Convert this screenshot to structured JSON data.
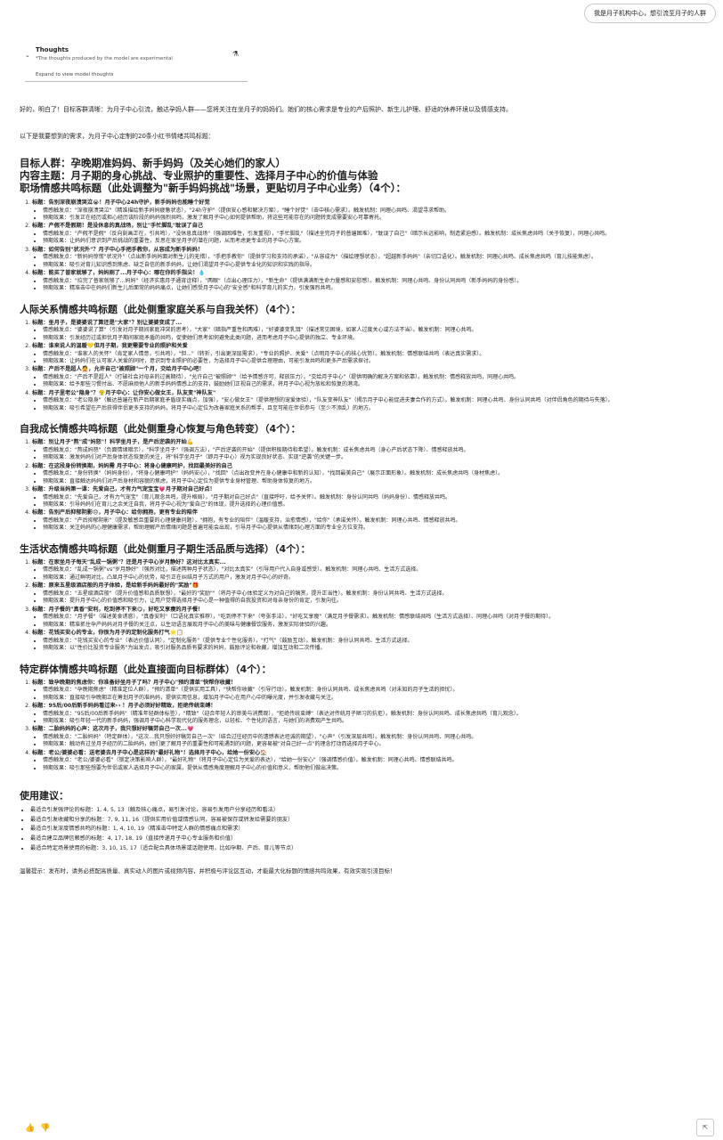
{
  "user_message": "我是月子机构中心，想引流至月子的人群",
  "thoughts": {
    "title": "Thoughts",
    "subtitle": "*The thoughts produced by the model are experimental",
    "expand": "Expand to view model thoughts"
  },
  "intro": "好的，明白了！目标客群清晰：为月子中心引流，触达孕妈人群——您将关注在坐月子的妈妈们。她们的核心需求是专业的产后照护、新生儿护理、舒适的休养环境以及情感支持。",
  "intro2": "以下是我要想到的需求，为月子中心定制的20条小红书情绪共鸣标题：",
  "header": {
    "audience": "目标人群：孕晚期准妈妈、新手妈妈（及关心她们的家人）",
    "theme": "内容主题：月子期的身心挑战、专业照护的重要性、选择月子中心的价值与体验",
    "section1": "职场情感共鸣标题（此处调整为\"新手妈妈挑战\"场景，更贴切月子中心业务）（4个）："
  },
  "sections": [
    {
      "title": "",
      "items": [
        {
          "t": "标题：告别深夜崩溃哭泣😭！月子中心24h守护，新手妈妈也能睡个好觉",
          "a": "情感触发点：\"深夜崩溃哭泣\"（精准描绘新手妈妈疲惫状态），\"24h守护\"（提供安心感和解决方案），\"睡个好觉\"（击中核心需求）。触发机制：同理心共鸣、渴望寻求帮助。",
          "b": "预期效果：引发正在经历或担心经历该阶段的妈妈强烈共鸣，激发了解月子中心如何提供帮助，将这些可能存在的问题转变成需要安心可靠寄托。"
        },
        {
          "t": "标题：产假不是假期！是没休息的真战场，别让\"手忙脚乱\"耽误了自己",
          "a": "情感触发点：\"产假不是假\"（反向刻画正在，引共鸣），\"没休息真战场\"（强调困难性，引发重视），\"手忙脚乱\"（描述坐完月子的普遍困难），\"耽误了自己\"（暗示长远影响，制造紧迫感）。触发机制：成长焦虑共鸣（关于恢复），同理心共鸣。",
          "b": "预期效果：让妈妈们意识到产后挑战的重要性，反思在家坐月子的潜在问题，从而考虑更专业的月子中心方案。"
        },
        {
          "t": "标题：如何告别\"状况外\"？月子中心手把手教你，从容成为新手妈妈！",
          "a": "情感触发点：\"新妈妈惊慌\"状况外\"（点出新手妈妈面对新生儿的无措），\"手把手教你\"（提供学习和支持的承诺），\"从容成为\"（描绘理想状态），\"超越新手妈妈\"（亲切口语化）。触发机制：同理心共鸣、成长焦虑共鸣（育儿技能焦虑）。",
          "b": "预期效果：吸引对育儿知识感到焦虑、缺乏自信的新手妈妈，让她们渴望月子中心提供专业化的知识和实践的指导。"
        },
        {
          "t": "标题：能买了普家就够了，妈妈刚了...月子中心：哪在你的手指尖！💧",
          "a": "情感触发点：\"拉完了普家就够了...妈妈\"（经济实惠月子通宵诠释），\"两眼\"（点出心理压力），\"新生命\"（提供满满新生命力量感和安慰感）。触发机制：同理心共鸣、身份认同共鸣（新手妈妈的身份感）。",
          "b": "预期效果：精准击中在妈妈们新生儿后面常的妈妈痛点，让她们感受月子中心的\"安全感\"和科学育儿的实力，引发强烈共鸣。"
        }
      ]
    },
    {
      "title": "人际关系情感共鸣标题（此处侧重家庭关系与自我关怀）（4个）：",
      "items": [
        {
          "t": "标题：坐月子，是婆婆说了算还是\"大家\"？别让婆婆变成了...",
          "a": "情感触发点：\"婆婆说了算\"（引发对月子期间家庭冲突的思考），\"大家\"（暗指严重性和两难），\"好婆婆变乳饵\"（描述常见困境，如家人过度关心或方法不当）。触发机制：同理心共鸣。",
          "b": "预期效果：引发经历过或担忧月子期间家庭矛盾的共鸣，促使她们思考如何避免此类问题，进而考虑月子中心提供的独立、专业环境。"
        },
        {
          "t": "标题：谁来说人的温暖💛但月子期，我更需要专业的照护和关爱",
          "a": "情感触发点：\"谁家人的关怀\"（肯定家人情意，引共鸣），\"但...\"（转折，引出更深层需求），\"专业的照护、关爱\"（点明月子中心的核心优势）。触发机制：情感联结共鸣（表达真实需求）。",
          "b": "预期效果：让妈妈们在认可家人关爱的同时，意识到专业照护的必要性，为选择月子中心提供合理理由，可能引发共鸣和更多产后需求探讨。"
        },
        {
          "t": "标题：产后不是超人🙅，允许自己\"被照顾\"一个月，交给月子中心吧！",
          "a": "情感触发点：\"产后不是超人\"（打破社会对母亲的过高期待），\"允许自己\"被照顾\"\"（给予情感许可，释放压力），\"交给月子中心\"（提供明确的解决方案和依靠）。触发机制：情感释放共鸣，同理心共鸣。",
          "b": "预期效果：给予那些习惯付出、不愿麻烦他人的新手妈妈情感上的支持，鼓励她们正视自己的需求，将月子中心视为放松和恢复的港湾。"
        },
        {
          "t": "标题：月子里老公\"隐身\"？😤月子中心：让你安心做女王，队友变\"神队友\"",
          "a": "情感触发点：\"老公隐身\"（触达普遍在新产后期家庭矛盾现实痛点，加强），\"安心做女王\"（提供理想的宠爱体验），\"队友变神队友\"（揭示月子中心能促进夫妻合作的方式）。触发机制：同理心共鸣、身份认同共鸣（对伴侣角色的期待与失落）。",
          "b": "预期效果：吸引希望在产后获得伴侣更多支持的妈妈，将月子中心定位为改善家庭关系的帮手，且至可能在伴侣参与（至少不添乱）的地方。"
        }
      ]
    },
    {
      "title": "自我成长情感共鸣标题（此处侧重身心恢复与角色转变）（4个）：",
      "items": [
        {
          "t": "标题：别让月子\"熬\"成\"妈怒\"！科学坐月子，是产后逆袭的开始💪",
          "a": "情感触发点：\"熬成妈怒\"（负面情绪暗示），\"科学坐月子\"（强调方法），\"产后逆袭的开始\"（提供积极期待和希望）。触发机制：成长焦虑共鸣（身心产后状态下降）、情感释放共鸣。",
          "b": "预期效果：激发妈妈们对产后身体状态恢复的关注，将\"科学坐月子\"（即月子中心）视为实现良好状态、实现\"逆袭\"的关键一步。"
        },
        {
          "t": "标题：在这段身份转换期，妈妈需 月子中心：将身心健康呵护，找回最美好的自己",
          "a": "情感触发点：\"身份转换\"（妈妈身份），\"将身心健康呵护\"（妈妈安心），\"找回\"（点出改变并在身心健康中和新的认知），\"找回最美自己\"（展示正面形象）。触发机制：成长焦虑共鸣（身材焦虑）。",
          "b": "预期效果：直接触达妈妈们对产后身材和容貌的焦虑，将月子中心定位为提供专业身材管理、帮助身体恢复的地方。"
        },
        {
          "t": "标题：升级当妈第一课：先爱自己，才有力气宠宝宝💗月子期对自己好点！",
          "a": "情感触发点：\"先爱自己，才有力气宠宝\"（育儿观念共鸣，提升格局），\"月子期对自己好点\"（直接呼吁，给予关怀）。触发机制：身份认同共鸣（妈妈身份）、情感释放共鸣。",
          "b": "预期效果：引导妈妈们在育儿之余关注自我，将月子中心视为\"爱自己\"的体现，提升选择的心理价值感。"
        },
        {
          "t": "标题：告别产后抑郁阴影😞，月子中心：给你拥抱，更有专业的陪伴",
          "a": "情感触发点：\"产后抑郁阴影\"（提及敏感且重要的心理健康问题），\"拥抱，有专业的陪伴\"（温暖支持，治愈情感），\"给你\"（承诺关怀）。触发机制：同理心共鸣、情感释放共鸣。",
          "b": "预期效果：关注妈妈的心理健康需求，帮助理解产后情绪问题是普遍可能会出现，引导月子中心提供从情绪到心理方面的专业全方位支持。"
        }
      ]
    },
    {
      "title": "生活状态情感共鸣标题（此处侧重月子期生活品质与选择）（4个）：",
      "items": [
        {
          "t": "标题：在家坐月子每天\"乱成一锅粥\"？还是月子中心岁月静好？这对比太真实...",
          "a": "情感触发点：\"乱成一锅粥\"vs\"岁月静好\"（强烈对比，描述两种月子状态），\"对比太真实\"（引导用户代入自身或感受）。触发机制：同理心共鸣、生活方式选择。",
          "b": "预期效果：通过鲜明对比，凸显月子中心的优势，吸引正在纠结月子方式的用户，激发对月子中心的好奇。"
        },
        {
          "t": "标题：原来五星级酒店般的月子体验，是给新手妈妈最好的\"奖励\"🎁",
          "a": "情感触发点：\"五星级酒店般\"（提升价值感和品质联想），\"最好的\"奖励\"\"（将月子中心体验定义为对自己的犒赏，提升正当性）。触发机制：身份认同共鸣、生活方式选择。",
          "b": "预期效果：提升月子中心的价值感和吸引力，让用户觉得选择月子中心是一种值得的自我投资和对母亲身份的肯定，引发向往。"
        },
        {
          "t": "标题：月子餐的\"真香\"安利，吃到停不下来😋，好吃又享瘦的月子餐！",
          "a": "情感触发点：\"月子餐\"（描述美食诱惑），\"真香安利\"（口语化真实推荐），\"吃到停不下来\"（夸张手法），\"好吃又享瘦\"（满足月子餐需求）。触发机制：情感联结共鸣（生活方式选择）、同理心共鸣（对月子餐的期待）。",
          "b": "预期效果：精准抓住孕产妈妈对月子餐的关注点，以生动语言展现月子中心的美味与健康餐饮服务，激发实际体验的兴趣。"
        },
        {
          "t": "标题：花钱买安心的专业，你很为月子的定制化服务打气🌟📋",
          "a": "情感触发点：\"花钱买安心的专业\"（表达价值认同），\"定制化服务\"（提供专业个性化服务），\"打气\"（鼓励互动）。触发机制：身份认同共鸣、生活方式选择。",
          "b": "预期效果：以\"性价比投资专业服务\"为出发点，吸引对服务品质有要求的妈妈，鼓励评论和收藏，增加互动和二次传播。"
        }
      ]
    },
    {
      "title": "特定群体情感共鸣标题（此处直接面向目标群体）（4个）：",
      "items": [
        {
          "t": "标题：致孕晚期的焦虑你：你准备好坐月子了吗？月子中心\"预约清单\"快帮你收藏！",
          "a": "情感触发点：\"孕晚期焦虑\"（精准定位人群），\"预约清单\"（提供实用工具），\"快帮你收藏\"（引导行动）。触发机制：身份认同共鸣、成长焦虑共鸣（对未知的月子生活的担忧）。",
          "b": "预期效果：直接吸引孕晚期正在筹划月子的准妈妈，提供实用信息，增加月子中心在用户心中的曝光度，并引发收藏与关注。"
        },
        {
          "t": "标题：95后/00后新手妈妈看过来👀！月子必须好好精致，拒绝传统束缚！",
          "a": "情感触发点：\"95后/00后新手妈妈\"（精准年轻群体标签），\"精致\"（迎合年轻人的审美与消费观），\"拒绝传统束缚\"（表达对传统月子陋习的抗拒）。触发机制：身份认同共鸣、成长焦虑共鸣（育儿观念）。",
          "b": "预期效果：吸引年轻一代的新手妈妈，强调月子中心科学现代化的服务理念，以轻松、个性化的语言，与她们的消费观产生共鸣。"
        },
        {
          "t": "标题：二胎妈妈的心声：这次月子，我只想好好犒劳自己一次...💗",
          "a": "情感触发点：\"二胎妈妈\"（特定群体），\"这次...我只想好好犒劳自己一次\"（结合过往经历中的遗憾表达坦诚的期望），\"心声\"（引发深层共鸣）。触发机制：身份认同共鸣、同理心共鸣。",
          "b": "预期效果：触动有过坐月子经历的二胎妈妈，她们更了解月子的重要性和可能遇到的问题，更容易被\"对自己好一点\"的理念打动而选择月子中心。"
        },
        {
          "t": "标题：老公/婆婆必看：送老婆去月子中心是这样的\"最好礼物\"！选择月子中心，给她一份安心🏠",
          "a": "情感触发点：\"老公/婆婆必看\"（锁定决策影响人群），\"最好礼物\"（将月子中心定位为关爱的表达），\"给她一份安心\"（强调情感价值）。触发机制：同理心共鸣、情感联结共鸣。",
          "b": "预期效果：吸引那些想要为伴侣或家人选择月子中心的家属，提供从情感角度理解月子中心的价值和意义，帮助他们做出决策。"
        }
      ]
    }
  ],
  "usage": {
    "title": "使用建议：",
    "items": [
      "最适合引发强评论的标题：1, 4, 5, 13（触及核心痛点，易引发讨论，容易引发用户分享经历和看法）",
      "最适合引发收藏和分享的标题：7, 9, 11, 16（提供实用价值或情感认同，容易被保存或转发给需要的朋友）",
      "最适合引发深度情感共鸣的标题：1, 4, 10, 19（精准击中特定人群的情感痛点和需求）",
      "最适合建立品牌信赖感的标题：4, 17, 18, 19（直接传递月子中心专业服务和价值）",
      "最适合特定场景使用的标题：3, 10, 15, 17（适合配合具体场景或话题使用，比如孕期、产后、育儿等节点）"
    ]
  },
  "tip": "温馨提示：发布时，请务必搭配高质量、真实动人的图片或视频内容，并积极与评论区互动，才能最大化标题的情感共鸣效果，有效实现引流目标！"
}
